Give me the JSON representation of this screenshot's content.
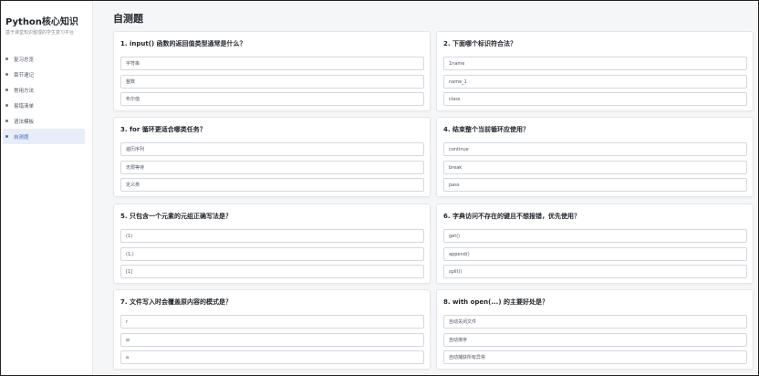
{
  "sidebar": {
    "title": "Python核心知识",
    "subtitle": "基于课堂知识整理的学生复习平台",
    "items": [
      {
        "label": "复习总览"
      },
      {
        "label": "章节速记"
      },
      {
        "label": "常用方法"
      },
      {
        "label": "易错清单"
      },
      {
        "label": "语法模板"
      },
      {
        "label": "自测题"
      }
    ]
  },
  "main": {
    "title": "自测题",
    "questions": [
      {
        "title": "1. input() 函数的返回值类型通常是什么？",
        "options": [
          "字符串",
          "整数",
          "布尔值"
        ]
      },
      {
        "title": "2. 下面哪个标识符合法？",
        "options": [
          "1name",
          "name_1",
          "class"
        ]
      },
      {
        "title": "3. for 循环更适合哪类任务？",
        "options": [
          "遍历序列",
          "无限等待",
          "定义类"
        ]
      },
      {
        "title": "4. 结束整个当前循环应使用？",
        "options": [
          "continue",
          "break",
          "pass"
        ]
      },
      {
        "title": "5. 只包含一个元素的元组正确写法是？",
        "options": [
          "(1)",
          "(1,)",
          "[1]"
        ]
      },
      {
        "title": "6. 字典访问不存在的键且不想报错，优先使用？",
        "options": [
          "get()",
          "append()",
          "split()"
        ]
      },
      {
        "title": "7. 文件写入时会覆盖原内容的模式是？",
        "options": [
          "r",
          "w",
          "a"
        ]
      },
      {
        "title": "8. with open(...) 的主要好处是？",
        "options": [
          "自动关闭文件",
          "自动排序",
          "自动捕获所有异常"
        ]
      }
    ]
  }
}
